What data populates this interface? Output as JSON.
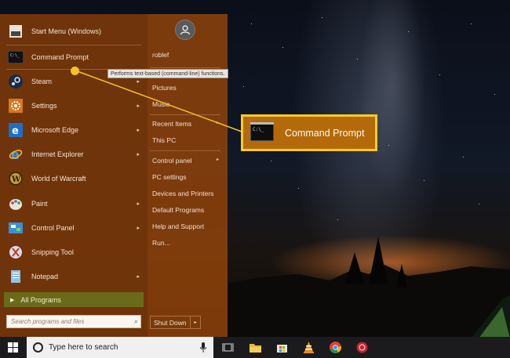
{
  "start_menu": {
    "items": [
      {
        "label": "Start Menu (Windows)",
        "icon": "start-menu-icon",
        "arrow": false
      },
      {
        "label": "Command Prompt",
        "icon": "command-prompt-icon",
        "arrow": false
      },
      {
        "label": "Steam",
        "icon": "steam-icon",
        "arrow": true
      },
      {
        "label": "Settings",
        "icon": "settings-icon",
        "arrow": true
      },
      {
        "label": "Microsoft Edge",
        "icon": "edge-icon",
        "arrow": true
      },
      {
        "label": "Internet Explorer",
        "icon": "internet-explorer-icon",
        "arrow": true
      },
      {
        "label": "World of Warcraft",
        "icon": "warcraft-icon",
        "arrow": false
      },
      {
        "label": "Paint",
        "icon": "paint-icon",
        "arrow": true
      },
      {
        "label": "Control Panel",
        "icon": "control-panel-icon",
        "arrow": true
      },
      {
        "label": "Snipping Tool",
        "icon": "snipping-tool-icon",
        "arrow": false
      },
      {
        "label": "Notepad",
        "icon": "notepad-icon",
        "arrow": true
      }
    ],
    "all_programs": "All Programs",
    "search_placeholder": "Search programs and files",
    "right_items": [
      {
        "label": "roblef",
        "arrow": false
      },
      {
        "label": "Pictures",
        "arrow": false
      },
      {
        "label": "Music",
        "arrow": false
      },
      {
        "label": "Recent Items",
        "arrow": true
      },
      {
        "label": "This PC",
        "arrow": false
      },
      {
        "label": "Control panel",
        "arrow": true
      },
      {
        "label": "PC settings",
        "arrow": false
      },
      {
        "label": "Devices and Printers",
        "arrow": false
      },
      {
        "label": "Default Programs",
        "arrow": false
      },
      {
        "label": "Help and Support",
        "arrow": false
      },
      {
        "label": "Run...",
        "arrow": false
      }
    ],
    "shutdown": "Shut Down"
  },
  "tooltip": "Performs text-based (command-line) functions.",
  "callout": {
    "label": "Command Prompt",
    "color": "#fbc92c"
  },
  "taskbar": {
    "search_placeholder": "Type here to search",
    "icons": [
      "windows-icon",
      "task-view-icon",
      "file-explorer-icon",
      "store-icon",
      "vlc-icon",
      "chrome-icon",
      "app-icon"
    ]
  },
  "colors": {
    "menu_bg": "#78370a",
    "accent": "#fbc92c",
    "taskbar": "#1b1b1d"
  }
}
